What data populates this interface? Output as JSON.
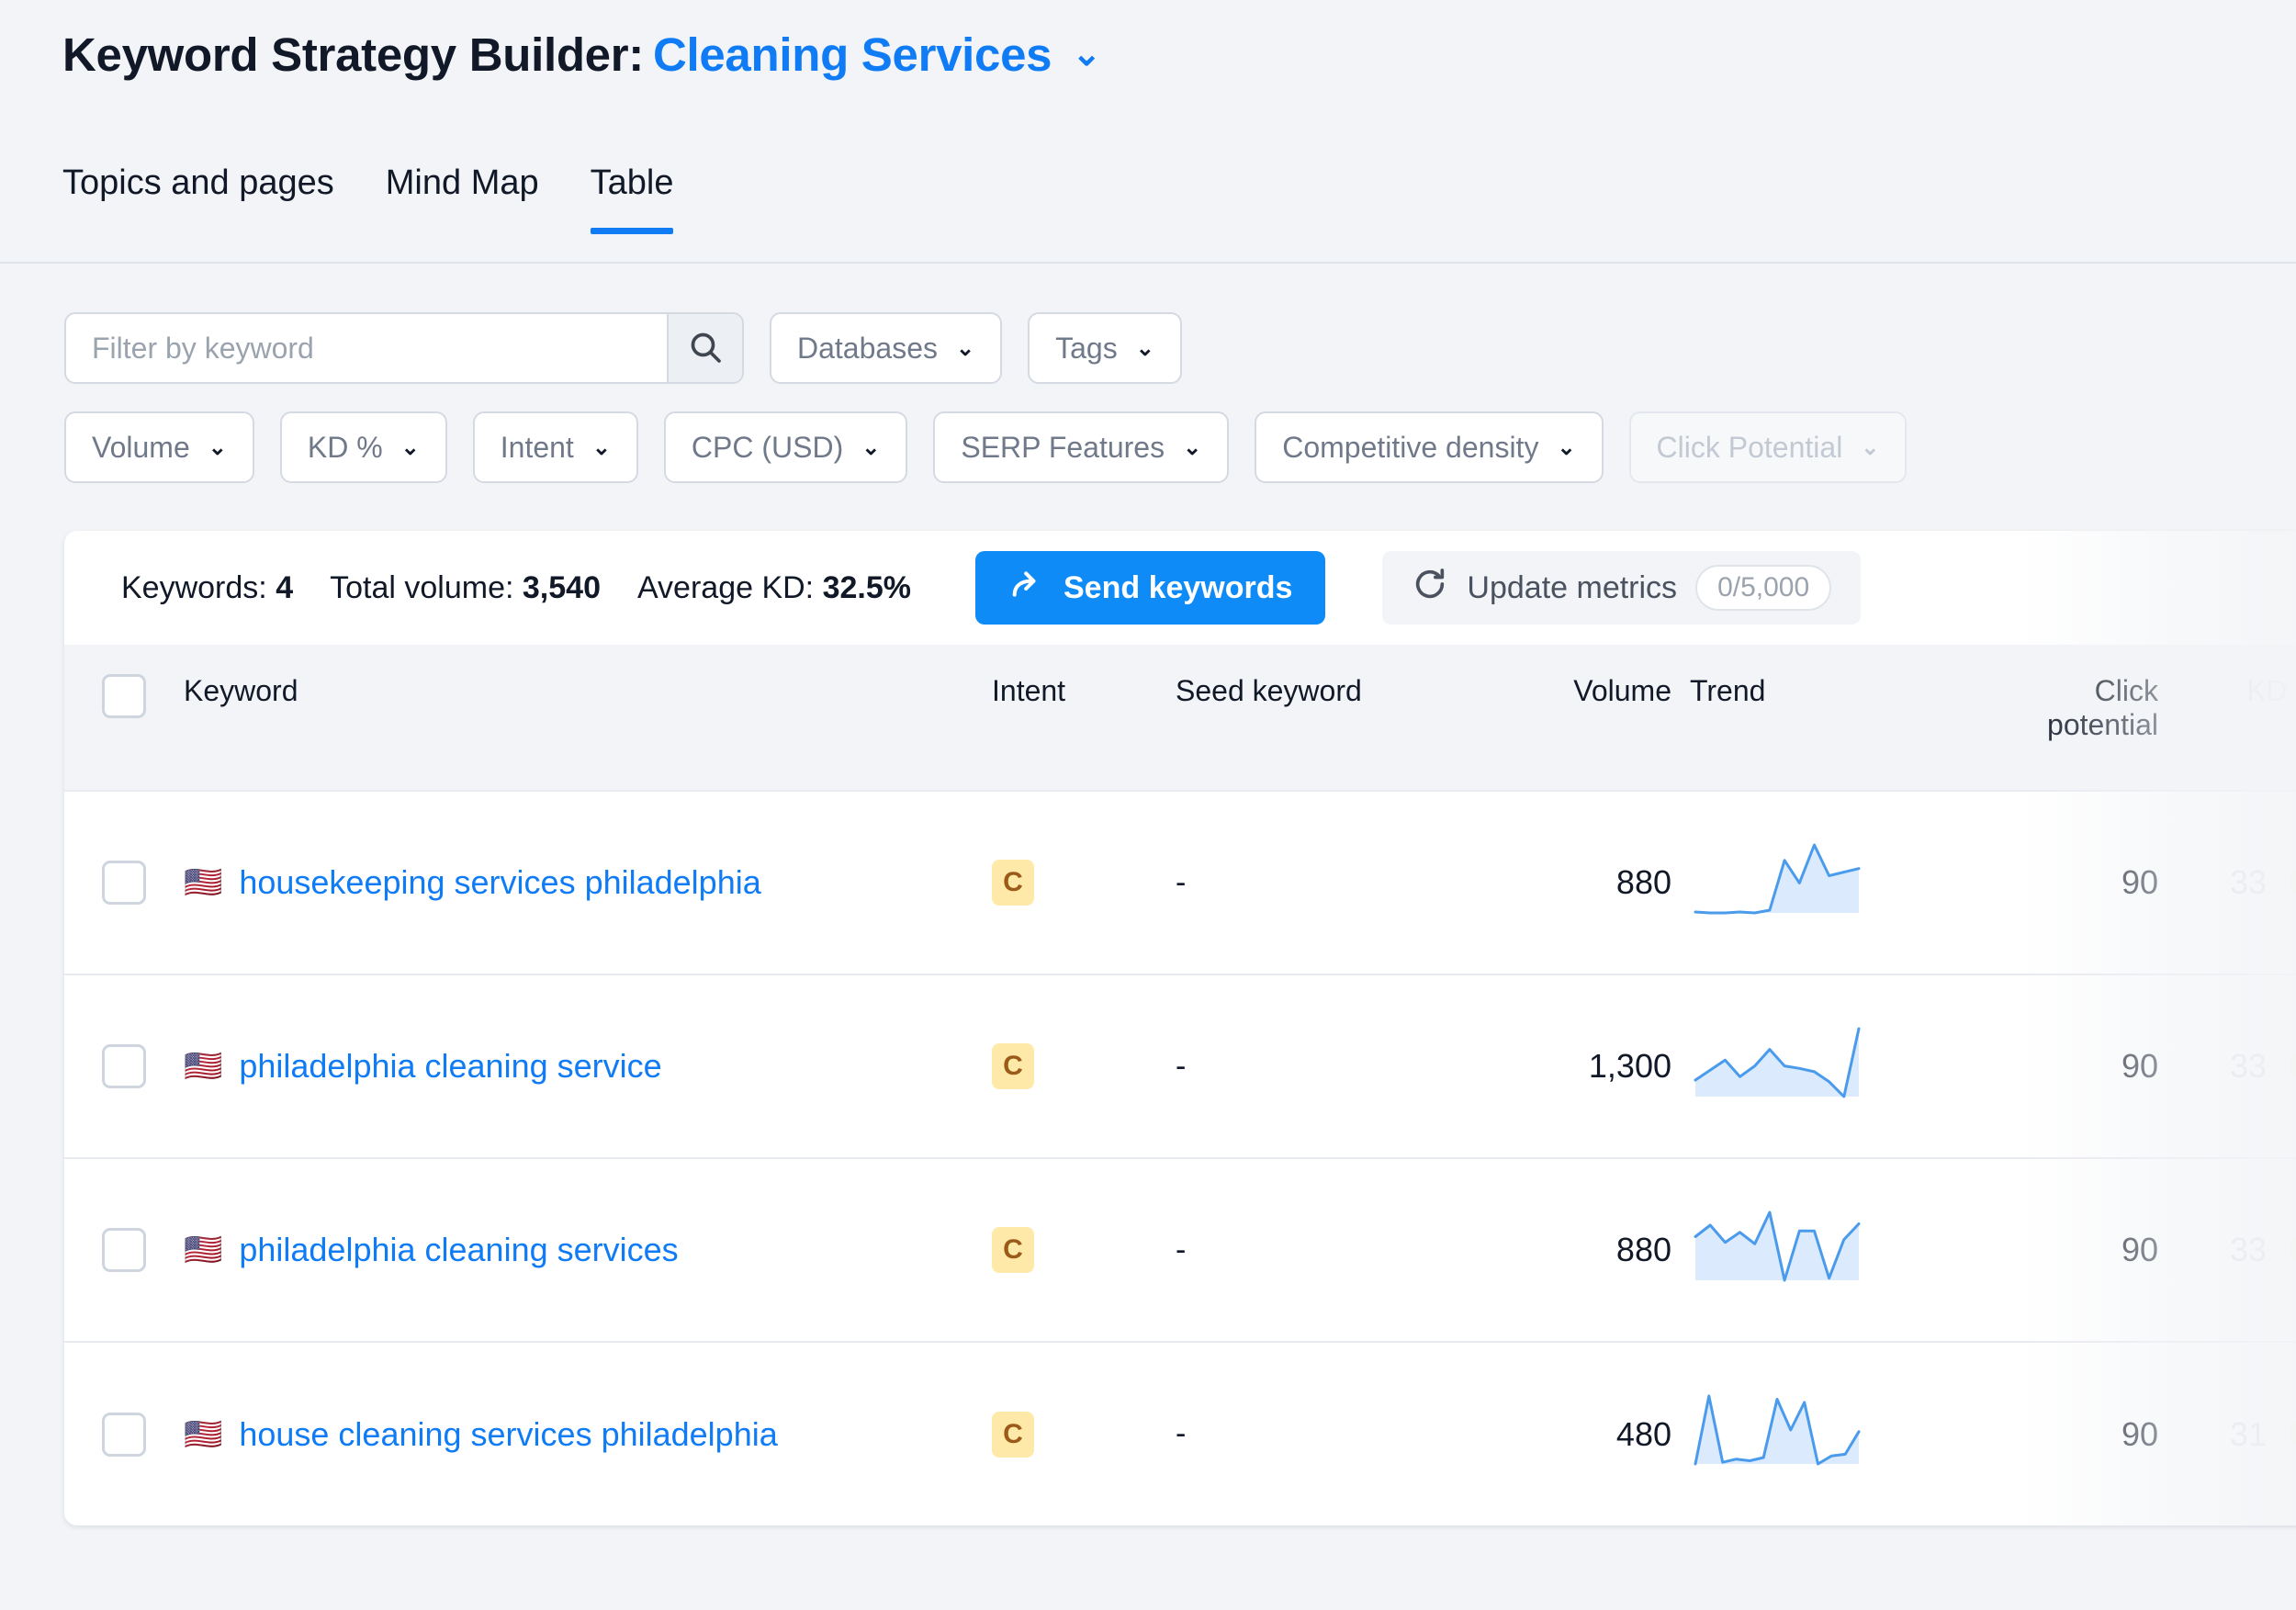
{
  "header": {
    "title_prefix": "Keyword Strategy Builder:",
    "project_name": "Cleaning Services",
    "caret": "⌄"
  },
  "tabs": [
    {
      "label": "Topics and pages",
      "active": false
    },
    {
      "label": "Mind Map",
      "active": false
    },
    {
      "label": "Table",
      "active": true
    }
  ],
  "filters": {
    "search_placeholder": "Filter by keyword",
    "search_value": "",
    "search_icon": "search-icon",
    "row1": [
      {
        "label": "Databases",
        "muted": false
      },
      {
        "label": "Tags",
        "muted": false
      }
    ],
    "row2": [
      {
        "label": "Volume",
        "muted": false
      },
      {
        "label": "KD %",
        "muted": false
      },
      {
        "label": "Intent",
        "muted": false
      },
      {
        "label": "CPC (USD)",
        "muted": false
      },
      {
        "label": "SERP Features",
        "muted": false
      },
      {
        "label": "Competitive density",
        "muted": false
      },
      {
        "label": "Click Potential",
        "muted": true
      }
    ]
  },
  "stats": {
    "keywords_label": "Keywords:",
    "keywords_value": "4",
    "volume_label": "Total volume:",
    "volume_value": "3,540",
    "kd_label": "Average KD:",
    "kd_value": "32.5%",
    "send_button": "Send keywords",
    "update_button": "Update metrics",
    "update_count": "0/5,000"
  },
  "table": {
    "columns": {
      "keyword": "Keyword",
      "intent": "Intent",
      "seed": "Seed keyword",
      "volume": "Volume",
      "trend": "Trend",
      "clicks": "Click\npotential",
      "clicks_line1": "Click",
      "clicks_line2": "potential",
      "kd": "KD %"
    },
    "rows": [
      {
        "selected": false,
        "flag": "🇺🇸",
        "keyword": "housekeeping services philadelphia",
        "intent": "C",
        "seed": "-",
        "volume": "880",
        "clicks": "90",
        "kd": "33",
        "trend": [
          18,
          17,
          17,
          18,
          17,
          20,
          75,
          50,
          92,
          58,
          62,
          66
        ]
      },
      {
        "selected": false,
        "flag": "🇺🇸",
        "keyword": "philadelphia cleaning service",
        "intent": "C",
        "seed": "-",
        "volume": "1,300",
        "clicks": "90",
        "kd": "33",
        "trend": [
          38,
          50,
          62,
          42,
          55,
          75,
          55,
          52,
          48,
          36,
          18,
          100
        ]
      },
      {
        "selected": false,
        "flag": "🇺🇸",
        "keyword": "philadelphia cleaning services",
        "intent": "C",
        "seed": "-",
        "volume": "880",
        "clicks": "90",
        "kd": "33",
        "trend": [
          66,
          82,
          58,
          72,
          56,
          100,
          5,
          74,
          74,
          8,
          62,
          84
        ]
      },
      {
        "selected": false,
        "flag": "🇺🇸",
        "keyword": "house cleaning services philadelphia",
        "intent": "C",
        "seed": "-",
        "volume": "480",
        "clicks": "90",
        "kd": "31",
        "trend": [
          8,
          92,
          10,
          14,
          12,
          16,
          88,
          50,
          84,
          8,
          18,
          20,
          48
        ]
      }
    ]
  },
  "colors": {
    "accent": "#0f7bf4",
    "button_blue": "#0f8bf7",
    "intent_bg": "#ffe9a8",
    "intent_fg": "#9a5a18",
    "trend_line": "#4a9bec",
    "trend_fill": "#dbeafd",
    "page_bg": "#f2f4f7"
  }
}
